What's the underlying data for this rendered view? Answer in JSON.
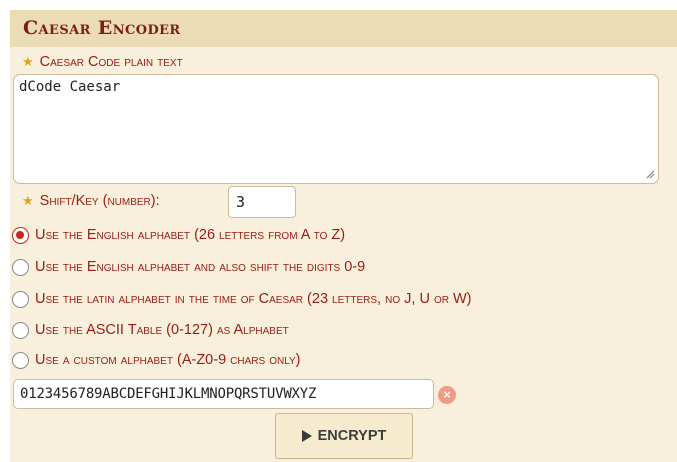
{
  "panel": {
    "title": "Caesar Encoder"
  },
  "plaintext": {
    "label": "Caesar Code plain text",
    "value": "dCode Caesar"
  },
  "shift": {
    "label": "Shift/Key (number):",
    "value": "3"
  },
  "alphabet_options": [
    {
      "label": "Use the English alphabet (26 letters from A to Z)",
      "checked": true
    },
    {
      "label": "Use the English alphabet and also shift the digits 0-9",
      "checked": false
    },
    {
      "label": "Use the latin alphabet in the time of Caesar (23 letters, no J, U or W)",
      "checked": false
    },
    {
      "label": "Use the ASCII Table (0-127) as Alphabet",
      "checked": false
    },
    {
      "label": "Use a custom alphabet (A-Z0-9 chars only)",
      "checked": false
    }
  ],
  "custom_alphabet": {
    "value": "0123456789ABCDEFGHIJKLMNOPQRSTUVWXYZ",
    "clear_icon": "clear-icon"
  },
  "encrypt_button": {
    "label": "ENCRYPT",
    "icon": "play-icon"
  },
  "colors": {
    "panel_bg": "#f8f0dc",
    "header_bg": "#ecdcb4",
    "label_red": "#9b1c12",
    "star": "#e3a21c"
  }
}
